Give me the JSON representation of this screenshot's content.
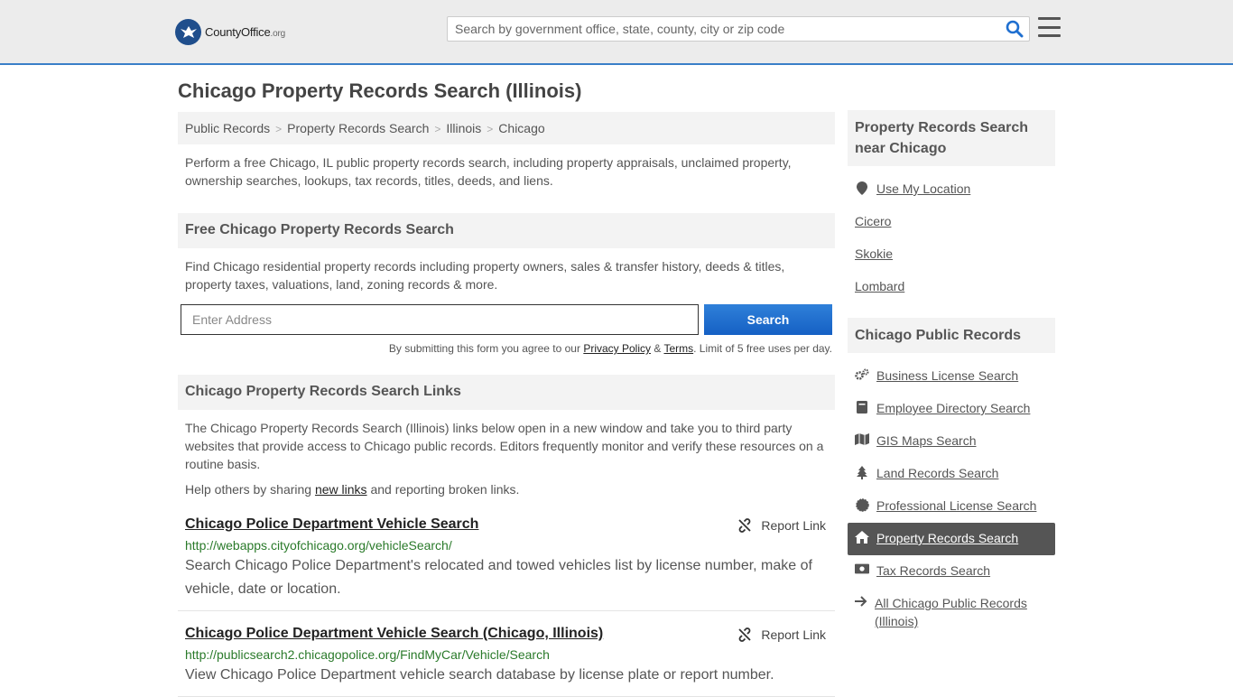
{
  "header": {
    "logo_main": "CountyOffice",
    "logo_suffix": ".org",
    "search_placeholder": "Search by government office, state, county, city or zip code"
  },
  "page_title": "Chicago Property Records Search (Illinois)",
  "breadcrumb": [
    "Public Records",
    "Property Records Search",
    "Illinois",
    "Chicago"
  ],
  "intro": "Perform a free Chicago, IL public property records search, including property appraisals, unclaimed property, ownership searches, lookups, tax records, titles, deeds, and liens.",
  "free_search": {
    "heading": "Free Chicago Property Records Search",
    "text": "Find Chicago residential property records including property owners, sales & transfer history, deeds & titles, property taxes, valuations, land, zoning records & more.",
    "address_placeholder": "Enter Address",
    "button": "Search",
    "disclaimer_pre": "By submitting this form you agree to our ",
    "privacy": "Privacy Policy",
    "amp": " & ",
    "terms": "Terms",
    "disclaimer_post": ". Limit of 5 free uses per day."
  },
  "links_section": {
    "heading": "Chicago Property Records Search Links",
    "text": "The Chicago Property Records Search (Illinois) links below open in a new window and take you to third party websites that provide access to Chicago public records. Editors frequently monitor and verify these resources on a routine basis.",
    "help_pre": "Help others by sharing ",
    "help_link": "new links",
    "help_post": " and reporting broken links."
  },
  "records": [
    {
      "title": "Chicago Police Department Vehicle Search",
      "url": "http://webapps.cityofchicago.org/vehicleSearch/",
      "desc": "Search Chicago Police Department's relocated and towed vehicles list by license number, make of vehicle, date or location.",
      "report": "Report Link"
    },
    {
      "title": "Chicago Police Department Vehicle Search (Chicago, Illinois)",
      "url": "http://publicsearch2.chicagopolice.org/FindMyCar/Vehicle/Search",
      "desc": "View Chicago Police Department vehicle search database by license plate or report number.",
      "report": "Report Link"
    }
  ],
  "sidebar": {
    "near_heading": "Property Records Search near Chicago",
    "near": [
      "Use My Location",
      "Cicero",
      "Skokie",
      "Lombard"
    ],
    "public_heading": "Chicago Public Records",
    "public": [
      {
        "label": "Business License Search",
        "icon": "gears-icon"
      },
      {
        "label": "Employee Directory Search",
        "icon": "book-icon"
      },
      {
        "label": "GIS Maps Search",
        "icon": "map-icon"
      },
      {
        "label": "Land Records Search",
        "icon": "tree-icon"
      },
      {
        "label": "Professional License Search",
        "icon": "certificate-icon"
      },
      {
        "label": "Property Records Search",
        "icon": "home-icon"
      },
      {
        "label": "Tax Records Search",
        "icon": "money-icon"
      },
      {
        "label": "All Chicago Public Records (Illinois)",
        "icon": "arrow-right-icon"
      }
    ]
  },
  "colors": {
    "accent": "#1f6fd0",
    "url_green": "#2a7a2a",
    "active_bg": "#555555"
  }
}
